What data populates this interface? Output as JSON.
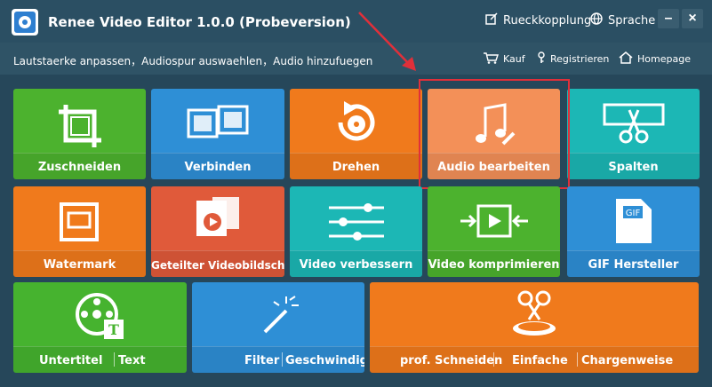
{
  "app": {
    "title": "Renee Video Editor 1.0.0 (Probeversion)",
    "feedback_label": "Rueckkopplung",
    "language_label": "Sprache"
  },
  "subbar": {
    "breadcrumb": "Lautstaerke anpassen，Audiospur auswaehlen，Audio hinzufuegen",
    "buy_label": "Kauf",
    "register_label": "Registrieren",
    "homepage_label": "Homepage"
  },
  "tiles": {
    "crop": "Zuschneiden",
    "merge": "Verbinden",
    "rotate": "Drehen",
    "audio": "Audio bearbeiten",
    "split": "Spalten",
    "watermark": "Watermark",
    "splitscreen": "Geteilter Videobildschirm",
    "enhance": "Video verbessern",
    "compress": "Video komprimieren",
    "gif": "GIF Hersteller",
    "subtitle": "Untertitel",
    "text": "Text",
    "filter": "Filter",
    "speed": "Geschwindigkeit",
    "pro_cut": "prof. Schneiden",
    "simple": "Einfache",
    "batch": "Chargenweise"
  },
  "colors": {
    "background": "#26475a",
    "green": "#4cb22e",
    "blue": "#2e8fd6",
    "orange": "#f07a1c",
    "salmon": "#f39058",
    "teal": "#1cb7b5",
    "red": "#e05a3a",
    "highlight": "#e0303a"
  }
}
